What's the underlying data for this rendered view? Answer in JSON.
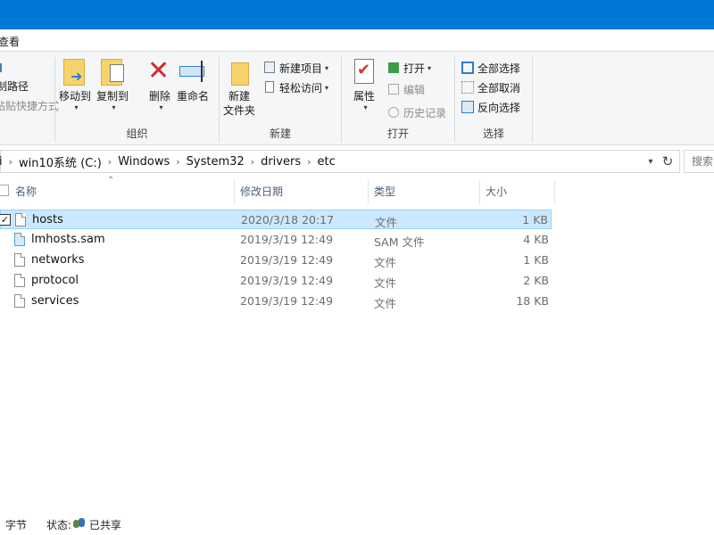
{
  "menu": {
    "view_tab": "查看"
  },
  "ribbon": {
    "clipboard": {
      "copy_path": "制路径",
      "paste_shortcut": "粘贴快捷方式"
    },
    "organize": {
      "label": "组织",
      "move_to": "移动到",
      "copy_to": "复制到",
      "delete": "删除",
      "rename": "重命名"
    },
    "new": {
      "label": "新建",
      "new_folder_line1": "新建",
      "new_folder_line2": "文件夹",
      "new_item": "新建项目",
      "easy_access": "轻松访问"
    },
    "open": {
      "label": "打开",
      "properties": "属性",
      "open": "打开",
      "edit": "编辑",
      "history": "历史记录"
    },
    "select": {
      "label": "选择",
      "select_all": "全部选择",
      "select_none": "全部取消",
      "invert": "反向选择"
    }
  },
  "address": {
    "crumbs": [
      "i",
      "win10系统 (C:)",
      "Windows",
      "System32",
      "drivers",
      "etc"
    ],
    "search_placeholder": "搜索"
  },
  "columns": {
    "name": "名称",
    "date": "修改日期",
    "type": "类型",
    "size": "大小"
  },
  "files": [
    {
      "name": "hosts",
      "date": "2020/3/18 20:17",
      "type": "文件",
      "size": "1 KB",
      "selected": true,
      "icon": "file-icon"
    },
    {
      "name": "lmhosts.sam",
      "date": "2019/3/19 12:49",
      "type": "SAM 文件",
      "size": "4 KB",
      "selected": false,
      "icon": "sam-file-icon"
    },
    {
      "name": "networks",
      "date": "2019/3/19 12:49",
      "type": "文件",
      "size": "1 KB",
      "selected": false,
      "icon": "file-icon"
    },
    {
      "name": "protocol",
      "date": "2019/3/19 12:49",
      "type": "文件",
      "size": "2 KB",
      "selected": false,
      "icon": "file-icon"
    },
    {
      "name": "services",
      "date": "2019/3/19 12:49",
      "type": "文件",
      "size": "18 KB",
      "selected": false,
      "icon": "file-icon"
    }
  ],
  "status": {
    "bytes": "字节",
    "state_label": "状态:",
    "state_value": "已共享"
  },
  "colors": {
    "title_bar": "#0078d7",
    "selection_bg": "#cce8ff",
    "selection_border": "#99d1ff"
  }
}
